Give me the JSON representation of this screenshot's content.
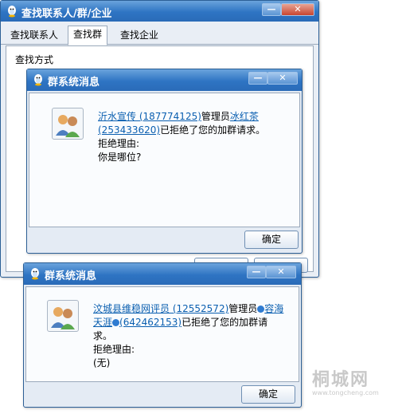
{
  "main_window": {
    "title": "查找联系人/群/企业",
    "tabs": [
      "查找联系人",
      "查找群",
      "查找企业"
    ],
    "section_label": "查找方式",
    "btn_minimize": "—",
    "btn_close": "✕"
  },
  "dialog1": {
    "title": "群系统消息",
    "line1_link": "沂水宣传 (187774125)",
    "line1_text": "管理员",
    "line1_admin_link": "冰红茶",
    "line2_link": "(253433620)",
    "line2_text": "已拒绝了您的加群请求。",
    "reason_label": "拒绝理由:",
    "reason_text": "你是哪位?",
    "ok_button": "确定",
    "btn_minimize": "—",
    "btn_close": "✕"
  },
  "dialog2": {
    "title": "群系统消息",
    "line1_link": "汶城县维稳网评员 (12552572)",
    "line1_text": "管理员",
    "line1_admin_link": "容海",
    "line2_link": "天涯",
    "line2_link2": "(642462153)",
    "line2_text": "已拒绝了您的加群请",
    "line3_text": "求。",
    "reason_label": "拒绝理由:",
    "reason_text": "(无)",
    "ok_button": "确定",
    "btn_minimize": "—",
    "btn_close": "✕"
  },
  "watermark": {
    "brand": "桐城网",
    "url": "www.tongcheng.com"
  }
}
